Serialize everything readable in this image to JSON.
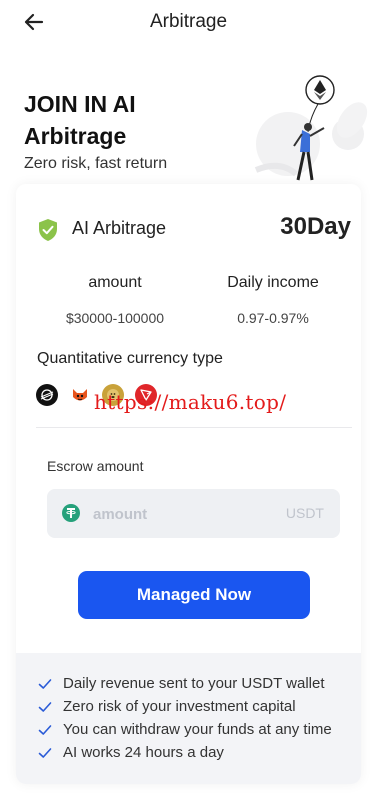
{
  "header": {
    "title": "Arbitrage",
    "back_icon": "arrow-left-icon"
  },
  "hero": {
    "title": "JOIN IN AI Arbitrage",
    "subtitle": "Zero risk, fast return"
  },
  "product": {
    "name": "AI Arbitrage",
    "period": "30Day",
    "stats": [
      {
        "label": "amount",
        "value": "$30000-100000"
      },
      {
        "label": "Daily income",
        "value": "0.97-0.97%"
      }
    ],
    "currency_label": "Quantitative currency type",
    "currencies": [
      "stellar-icon",
      "shiba-icon",
      "doge-icon",
      "tron-icon"
    ],
    "watermark": "https://maku6.top/"
  },
  "escrow": {
    "label": "Escrow amount",
    "placeholder": "amount",
    "value": "",
    "unit": "USDT"
  },
  "cta": {
    "label": "Managed Now"
  },
  "features": [
    "Daily revenue sent to your USDT wallet",
    "Zero risk of your investment capital",
    "You can withdraw your funds at any time",
    "AI works 24 hours a day"
  ],
  "colors": {
    "accent": "#1a56f0",
    "shield": "#8bc34a",
    "watermark": "#e31b1b",
    "usdt": "#26a17b"
  }
}
